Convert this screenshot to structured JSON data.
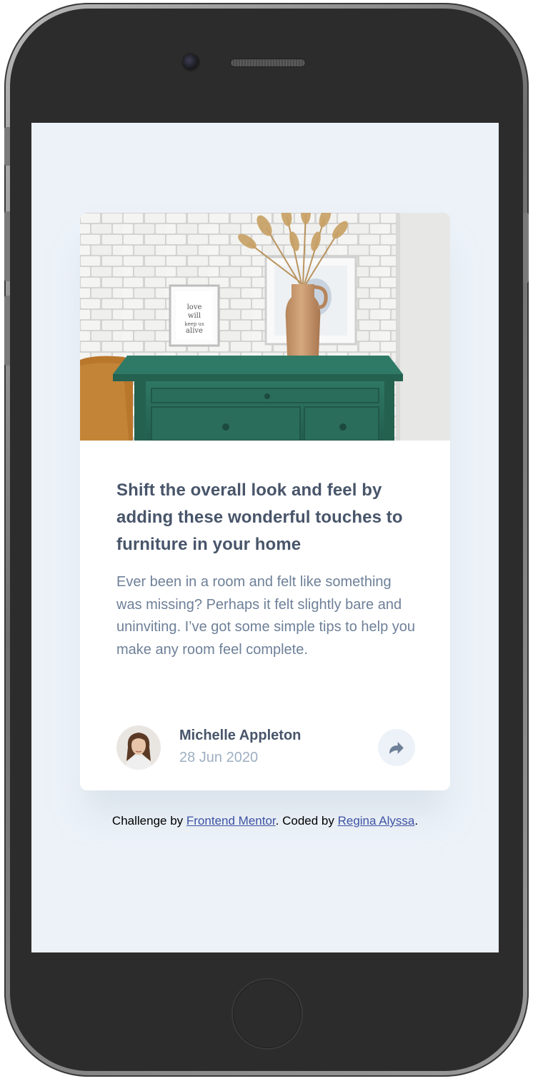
{
  "card": {
    "title": "Shift the overall look and feel by adding these wonderful touches to furniture in your home",
    "excerpt": "Ever been in a room and felt like something was missing? Perhaps it felt slightly bare and uninviting. I’ve got some simple tips to help you make any room feel complete.",
    "author": {
      "name": "Michelle Appleton",
      "date": "28 Jun 2020"
    },
    "share_icon": "share-arrow-icon"
  },
  "attribution": {
    "prefix": "Challenge by ",
    "challenge_link": "Frontend Mentor",
    "middle": ". Coded by ",
    "coder_link": "Regina Alyssa",
    "suffix": "."
  },
  "colors": {
    "page_background": "#ecf2f8",
    "card_background": "#ffffff",
    "title_text": "#48556a",
    "body_text": "#6e8098",
    "muted_text": "#9eafc2",
    "link": "#3e52a3"
  }
}
